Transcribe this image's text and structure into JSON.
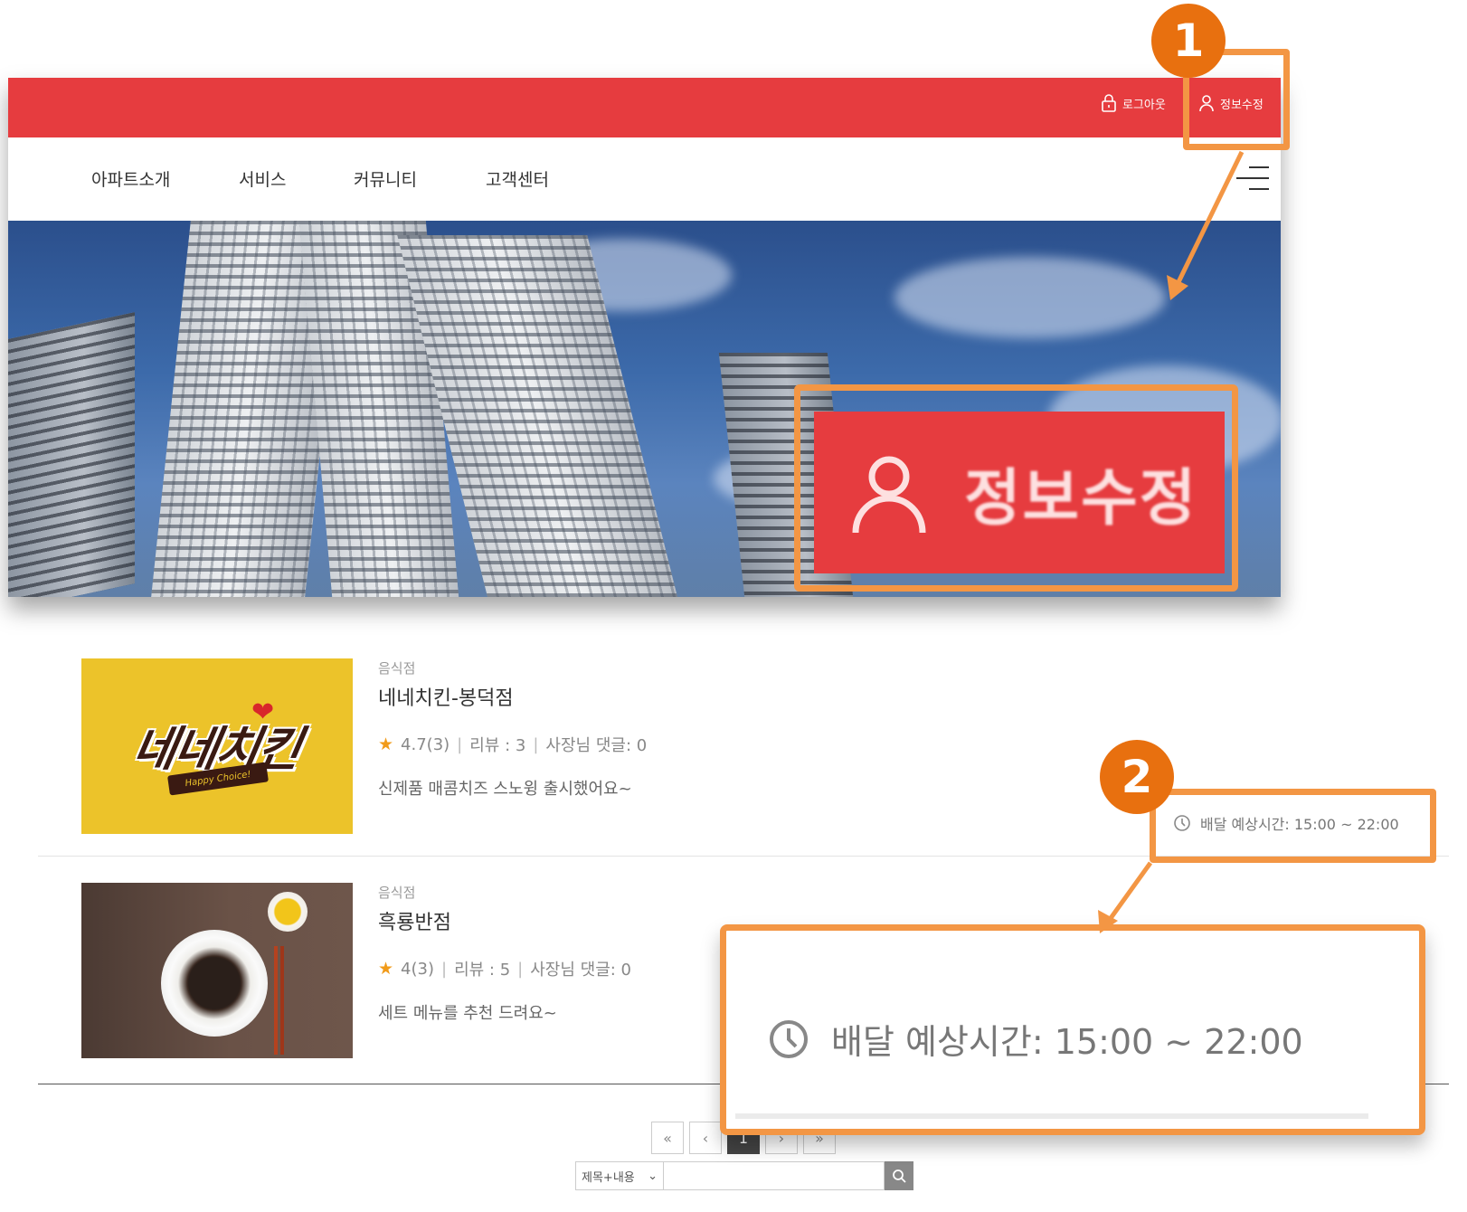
{
  "topbar": {
    "logout_label": "로그아웃",
    "edit_label": "정보수정",
    "color": "#e63c3f"
  },
  "nav": {
    "items": [
      "아파트소개",
      "서비스",
      "커뮤니티",
      "고객센터"
    ],
    "menu_icon": "hamburger-icon"
  },
  "callout1": {
    "badge": "1",
    "zoom_label": "정보수정",
    "accent": "#f39644",
    "badge_color": "#e8700f"
  },
  "stores": [
    {
      "category": "음식점",
      "name": "네네치킨-봉덕점",
      "rating": "4.7(3)",
      "reviews": "리뷰 : 3",
      "owner_replies": "사장님 댓글: 0",
      "description": "신제품 매콤치즈 스노윙 출시했어요~",
      "logo_text": "네네치킨",
      "logo_ribbon": "Happy Choice!"
    },
    {
      "category": "음식점",
      "name": "흑룡반점",
      "rating": "4(3)",
      "reviews": "리뷰 : 5",
      "owner_replies": "사장님 댓글: 0",
      "description": "세트 메뉴를 추천 드려요~"
    }
  ],
  "callout2": {
    "badge": "2",
    "delivery_time": "배달 예상시간: 15:00 ~ 22:00"
  },
  "pagination": {
    "first": "«",
    "prev": "‹",
    "current": "1",
    "next": "›",
    "last": "»"
  },
  "search": {
    "select_value": "제목+내용",
    "placeholder": "",
    "button_icon": "search-icon"
  }
}
